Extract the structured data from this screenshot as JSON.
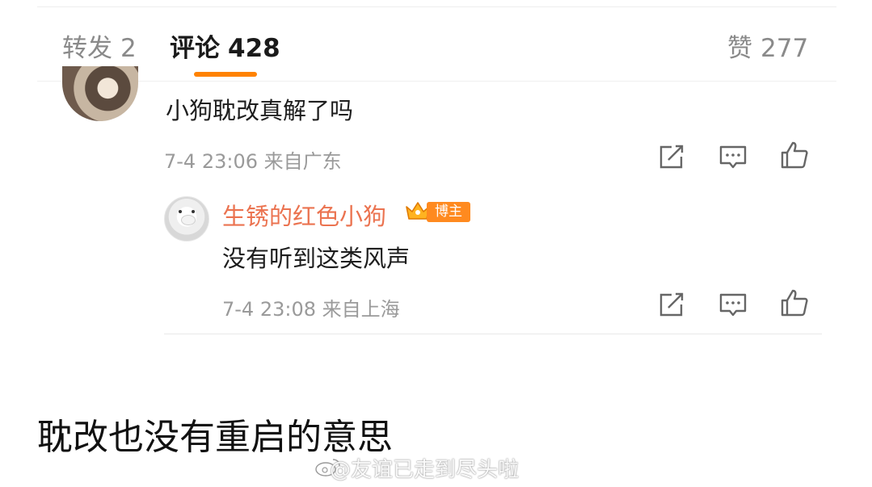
{
  "tabs": {
    "repost": {
      "label": "转发",
      "count": "2"
    },
    "comment": {
      "label": "评论",
      "count": "428"
    },
    "like": {
      "label": "赞",
      "count": "277"
    }
  },
  "comment": {
    "text": "小狗耽改真解了吗",
    "meta": "7-4 23:06  来自广东"
  },
  "reply": {
    "username": "生锈的红色小狗",
    "badge": "博主",
    "text": "没有听到这类风声",
    "meta": "7-4 23:08  来自上海"
  },
  "caption": "耽改也没有重启的意思",
  "watermark": "@友谊已走到尽头啦",
  "colors": {
    "accent": "#ff8200",
    "username": "#eb7350",
    "badge": "#ff8a1f"
  },
  "icons": [
    "edit-icon",
    "comment-icon",
    "like-icon",
    "crown-icon",
    "weibo-logo-icon"
  ]
}
